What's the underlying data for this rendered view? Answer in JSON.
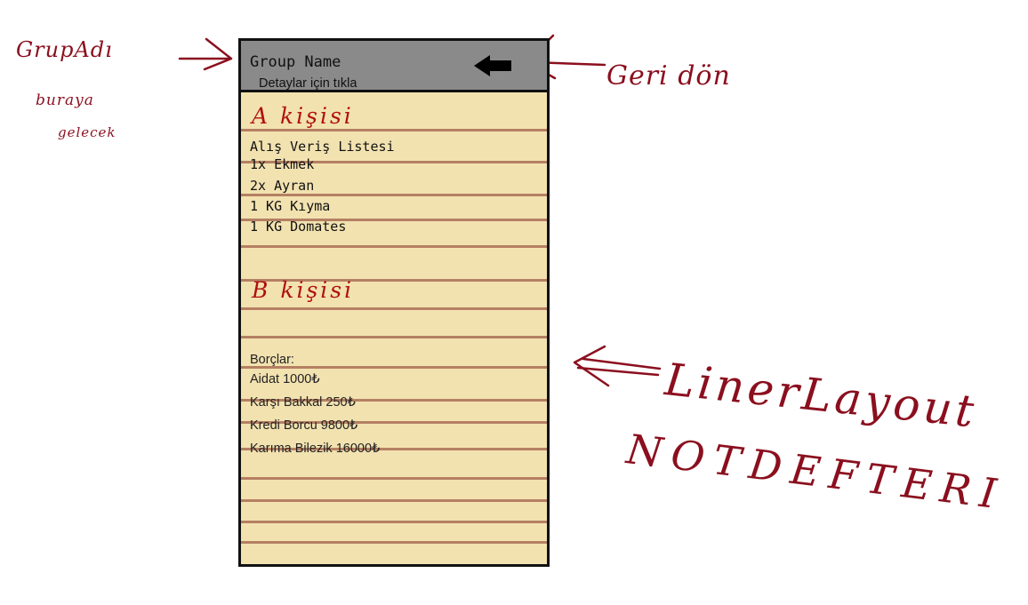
{
  "annotations": {
    "group_name_note_line1": "GrupAdı",
    "group_name_note_line2": "buraya",
    "group_name_note_line3": "gelecek",
    "back_note": "Geri dön",
    "list_layout_note": "LinerLayout",
    "notebook_note": "NOTDEFTERI"
  },
  "header": {
    "group_name": "Group Name",
    "subtitle": "Detaylar için tıkla",
    "back_icon": "arrow-left-icon"
  },
  "section_a": {
    "label": "A kişisi",
    "title": "Alış Veriş Listesi",
    "items": [
      "1x Ekmek",
      "2x Ayran",
      "1 KG Kıyma",
      "1 KG Domates"
    ]
  },
  "section_b": {
    "label": "B kişisi",
    "title": "Borçlar:",
    "items": [
      "Aidat 1000₺",
      "Karşı Bakkal 250₺",
      "Kredi Borcu 9800₺",
      "Karıma Bilezik 16000₺"
    ]
  },
  "colors": {
    "paper": "#f2e2b0",
    "rule": "#b58063",
    "header": "#8a8a8a",
    "annotation": "#8b0f1e",
    "section_label": "#b01010"
  }
}
